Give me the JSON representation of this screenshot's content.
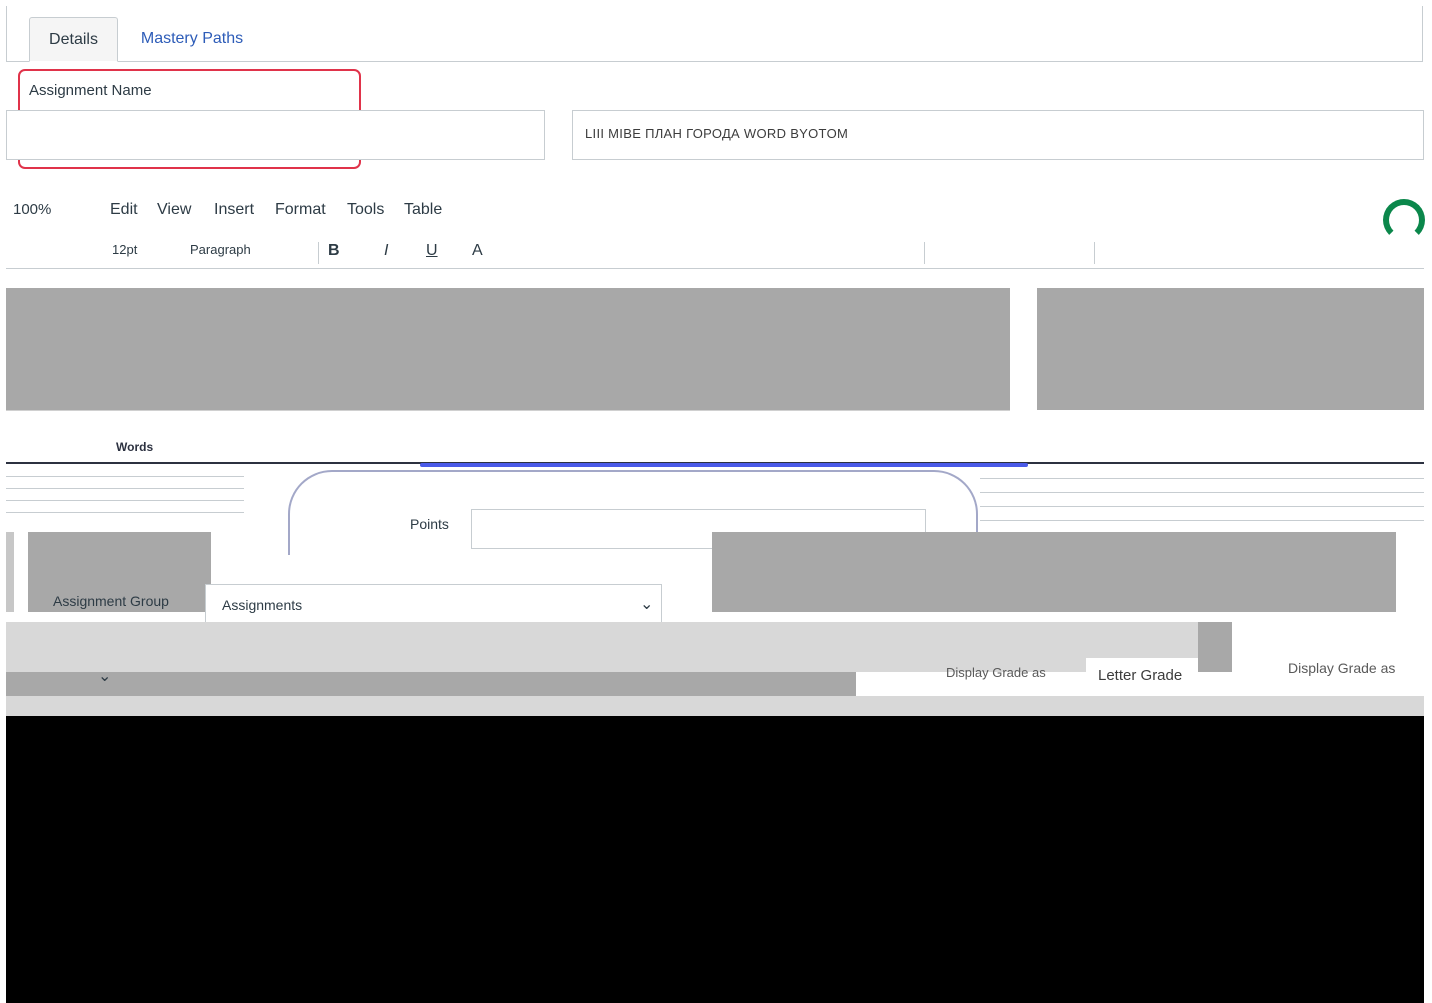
{
  "tabs": [
    {
      "label": "Details"
    },
    {
      "label": "Mastery Paths"
    }
  ],
  "assignment": {
    "name_label": "Assignment Name",
    "right_field_value": "LIII MIBE ПЛАН ГОРОДА WORD BYOTOM"
  },
  "editor": {
    "zoom": "100%",
    "menu": [
      "Edit",
      "View",
      "Insert",
      "Format",
      "Tools",
      "Table"
    ],
    "toolbar": {
      "font_size": "12pt",
      "block_format": "Paragraph",
      "bold": "B",
      "italic": "I",
      "underline": "U",
      "text_color": "A"
    },
    "word_count": "Words"
  },
  "points": {
    "label": "Points"
  },
  "assignment_group": {
    "label": "Assignment Group",
    "value": "Assignments"
  },
  "display_grade": {
    "label": "Display Grade as",
    "value": "Letter Grade",
    "label_right": "Display Grade as"
  },
  "colors": {
    "link": "#2d5cb8",
    "error": "#e0334a",
    "focus": "#4a5ae8",
    "spinner": "#0b874b"
  },
  "icons": [
    "chevron-down-icon",
    "loading-spinner-icon"
  ]
}
